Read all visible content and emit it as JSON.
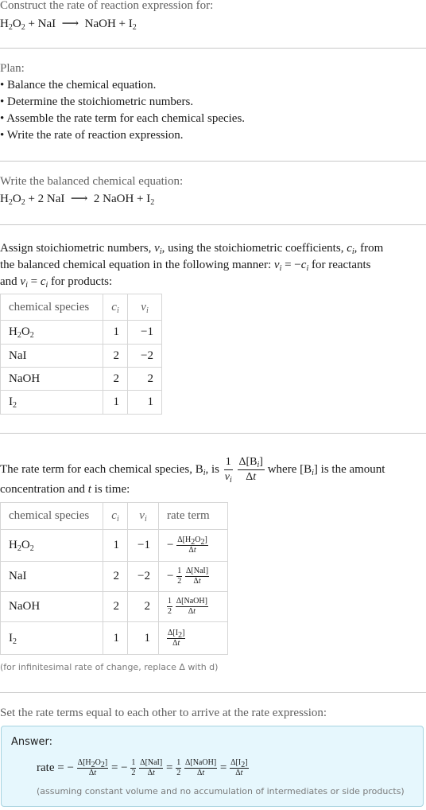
{
  "intro": {
    "title": "Construct the rate of reaction expression for:",
    "reaction_unbalanced": {
      "reactants": [
        "H2O2",
        "NaI"
      ],
      "products": [
        "NaOH",
        "I2"
      ],
      "arrow": "⟶",
      "plus": "+"
    }
  },
  "plan": {
    "heading": "Plan:",
    "items": [
      "Balance the chemical equation.",
      "Determine the stoichiometric numbers.",
      "Assemble the rate term for each chemical species.",
      "Write the rate of reaction expression."
    ]
  },
  "balanced": {
    "heading": "Write the balanced chemical equation:",
    "equation": "H2O2 + 2 NaI ⟶ 2 NaOH + I2"
  },
  "stoich": {
    "text_line1": "Assign stoichiometric numbers, νi, using the stoichiometric coefficients, ci, from",
    "text_line2": "the balanced chemical equation in the following manner: νi = −ci for reactants",
    "text_line3": "and νi = ci for products:",
    "columns": [
      "chemical species",
      "ci",
      "νi"
    ],
    "rows": [
      {
        "species": "H2O2",
        "c": "1",
        "nu": "−1"
      },
      {
        "species": "NaI",
        "c": "2",
        "nu": "−2"
      },
      {
        "species": "NaOH",
        "c": "2",
        "nu": "2"
      },
      {
        "species": "I2",
        "c": "1",
        "nu": "1"
      }
    ]
  },
  "rate_terms": {
    "text_before": "The rate term for each chemical species, Bi, is",
    "text_after": "where [Bi] is the amount",
    "text_line2": "concentration and t is time:",
    "columns": [
      "chemical species",
      "ci",
      "νi",
      "rate term"
    ],
    "rows": [
      {
        "species": "H2O2",
        "c": "1",
        "nu": "−1",
        "term": "−Δ[H2O2]/Δt"
      },
      {
        "species": "NaI",
        "c": "2",
        "nu": "−2",
        "term": "−1/2 Δ[NaI]/Δt"
      },
      {
        "species": "NaOH",
        "c": "2",
        "nu": "2",
        "term": "1/2 Δ[NaOH]/Δt"
      },
      {
        "species": "I2",
        "c": "1",
        "nu": "1",
        "term": "Δ[I2]/Δt"
      }
    ],
    "footnote": "(for infinitesimal rate of change, replace Δ with d)"
  },
  "answer": {
    "intro": "Set the rate terms equal to each other to arrive at the rate expression:",
    "label": "Answer:",
    "expression": "rate = −Δ[H2O2]/Δt = −1/2 Δ[NaI]/Δt = 1/2 Δ[NaOH]/Δt = Δ[I2]/Δt",
    "note": "(assuming constant volume and no accumulation of intermediates or side products)",
    "box_bg": "#e6f7fd",
    "box_border": "#a6d3e0"
  }
}
